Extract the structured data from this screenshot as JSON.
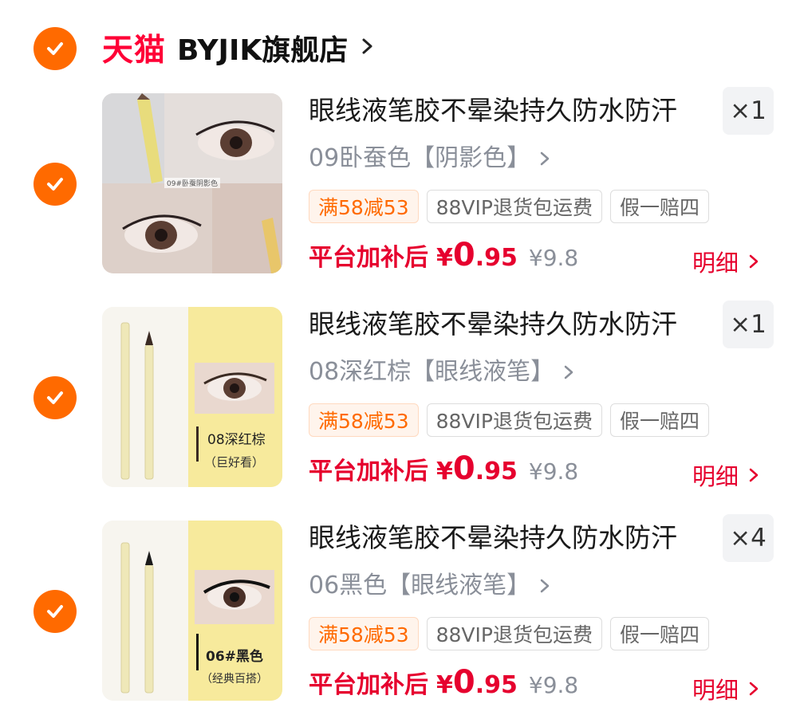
{
  "store": {
    "brand_label": "天猫",
    "name": "BYJIK旗舰店"
  },
  "colors": {
    "accent": "#ff6a00",
    "price_red": "#e6002e",
    "tmall_red": "#ff0036"
  },
  "items": [
    {
      "title": "眼线液笔胶不晕染持久防水防汗",
      "quantity": "×1",
      "variant": "09卧蚕色【阴影色】",
      "thumb_caption": "09#卧蚕阴影色",
      "tags": [
        "满58减53",
        "88VIP退货包运费",
        "假一赔四"
      ],
      "platform_label": "平台加补后",
      "currency": "¥",
      "price_int": "0",
      "price_dec": ".95",
      "original_price": "¥9.8",
      "detail_label": "明细"
    },
    {
      "title": "眼线液笔胶不晕染持久防水防汗",
      "quantity": "×1",
      "variant": "08深红棕【眼线液笔】",
      "thumb_label": "08深红棕",
      "thumb_sub": "（巨好看）",
      "tags": [
        "满58减53",
        "88VIP退货包运费",
        "假一赔四"
      ],
      "platform_label": "平台加补后",
      "currency": "¥",
      "price_int": "0",
      "price_dec": ".95",
      "original_price": "¥9.8",
      "detail_label": "明细"
    },
    {
      "title": "眼线液笔胶不晕染持久防水防汗",
      "quantity": "×4",
      "variant": "06黑色【眼线液笔】",
      "thumb_label": "06#黑色",
      "thumb_sub": "（经典百搭）",
      "tags": [
        "满58减53",
        "88VIP退货包运费",
        "假一赔四"
      ],
      "platform_label": "平台加补后",
      "currency": "¥",
      "price_int": "0",
      "price_dec": ".95",
      "original_price": "¥9.8",
      "detail_label": "明细"
    }
  ]
}
